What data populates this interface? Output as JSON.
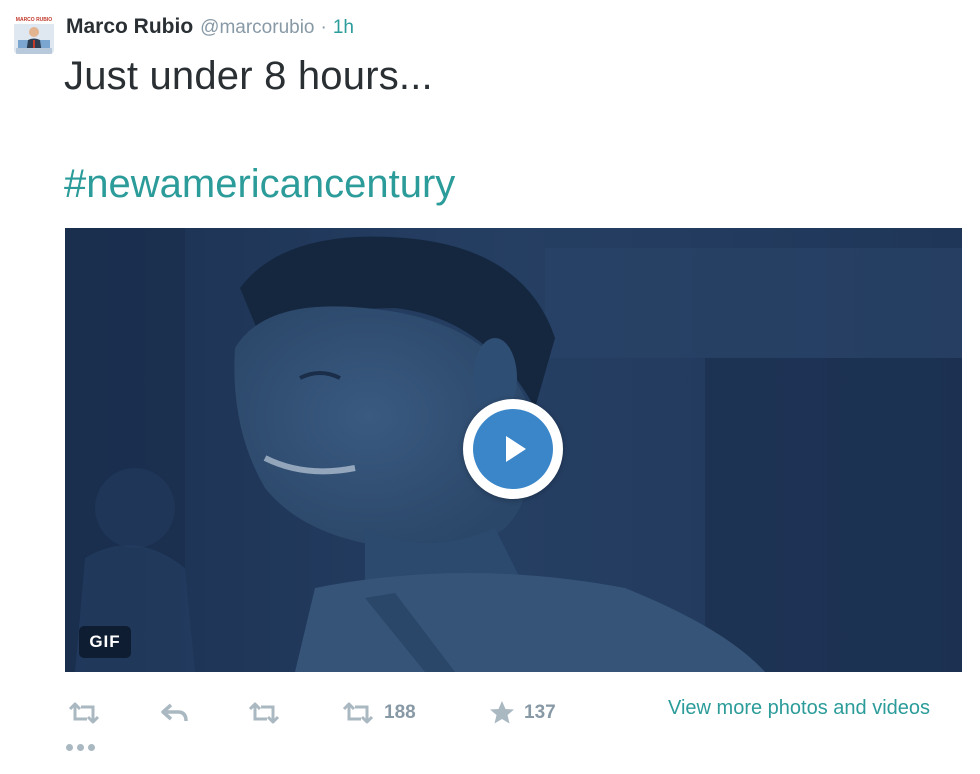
{
  "tweet": {
    "author": {
      "name": "Marco Rubio",
      "handle": "@marcorubio",
      "avatar_icon": "profile-avatar",
      "avatar_text": "MARCO RUBIO"
    },
    "separator": "·",
    "time": "1h",
    "text": "Just under 8 hours...",
    "hashtag": "#newamericancentury",
    "media": {
      "type_label": "GIF",
      "play_icon": "play-icon",
      "overlay_color": "#21385a",
      "play_color": "#3a86c8"
    },
    "actions": {
      "retweet_icon": "retweet-icon",
      "reply_icon": "reply-icon",
      "retweet_count": "188",
      "favorite_icon": "star-icon",
      "favorite_count": "137",
      "view_more_label": "View more photos and videos",
      "more_icon": "more-dots-icon"
    }
  },
  "colors": {
    "accent": "#2b9c9a",
    "text": "#292f33",
    "muted": "#8899a6",
    "icon": "#aab8c2"
  }
}
